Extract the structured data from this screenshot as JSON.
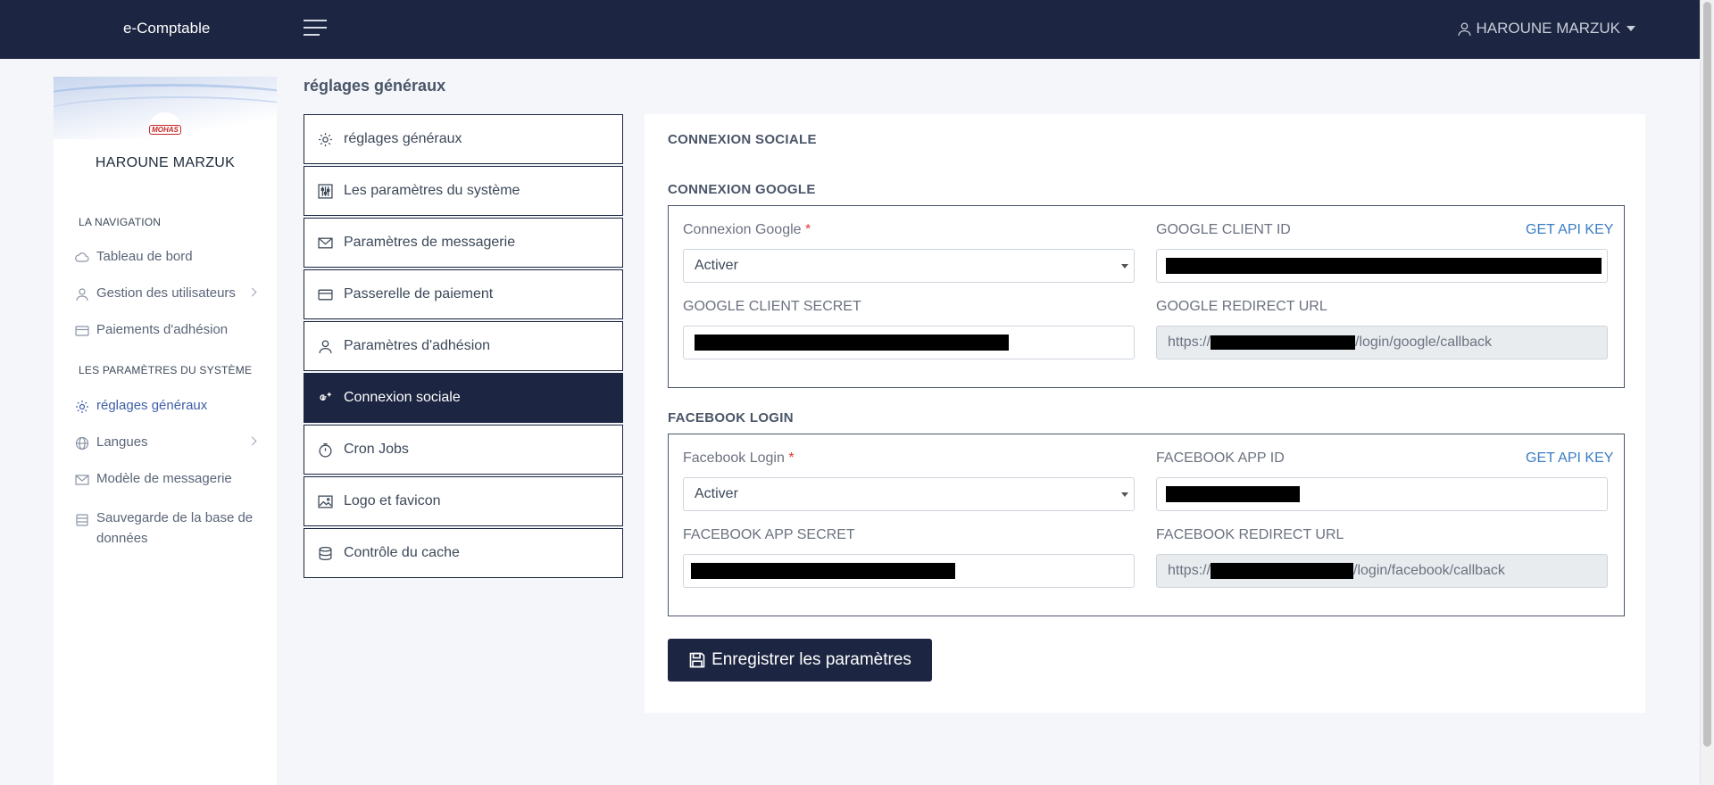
{
  "app": {
    "brand": "e-Comptable"
  },
  "topbar": {
    "user_name": "HAROUNE MARZUK"
  },
  "sidebar": {
    "logo_text": "MOHAS",
    "profile_name": "HAROUNE MARZUK",
    "sections": [
      {
        "title": "LA NAVIGATION"
      },
      {
        "title": "LES PARAMÈTRES DU SYSTÈME"
      }
    ],
    "items": [
      {
        "label": "Tableau de bord",
        "icon": "cloud-icon"
      },
      {
        "label": "Gestion des utilisateurs",
        "icon": "user-icon"
      },
      {
        "label": "Paiements d'adhésion",
        "icon": "card-icon"
      },
      {
        "label": "réglages généraux",
        "icon": "gear-icon"
      },
      {
        "label": "Langues",
        "icon": "globe-icon"
      },
      {
        "label": "Modèle de messagerie",
        "icon": "envelope-icon"
      },
      {
        "label": "Sauvegarde de la base de",
        "label2": "données",
        "icon": "database-icon"
      }
    ]
  },
  "page": {
    "title": "réglages généraux"
  },
  "settings_menu": {
    "items": [
      {
        "label": "réglages généraux",
        "icon": "gear-icon"
      },
      {
        "label": "Les paramètres du système",
        "icon": "sliders-icon"
      },
      {
        "label": "Paramètres de messagerie",
        "icon": "envelope-icon"
      },
      {
        "label": "Passerelle de paiement",
        "icon": "card-icon"
      },
      {
        "label": "Paramètres d'adhésion",
        "icon": "user-icon"
      },
      {
        "label": "Connexion sociale",
        "icon": "google-plus-icon",
        "active": true
      },
      {
        "label": "Cron Jobs",
        "icon": "stopwatch-icon"
      },
      {
        "label": "Logo et favicon",
        "icon": "image-icon"
      },
      {
        "label": "Contrôle du cache",
        "icon": "database-icon"
      }
    ]
  },
  "card": {
    "title": "CONNEXION SOCIALE",
    "google": {
      "title": "CONNEXION GOOGLE",
      "login_label": "Connexion Google",
      "required_mark": "*",
      "login_value": "Activer",
      "client_id_label": "GOOGLE CLIENT ID",
      "api_link": "GET API KEY",
      "client_secret_label": "GOOGLE CLIENT SECRET",
      "redirect_label": "GOOGLE REDIRECT URL",
      "redirect_prefix": "https://",
      "redirect_suffix": "/login/google/callback"
    },
    "facebook": {
      "title": "FACEBOOK LOGIN",
      "login_label": "Facebook Login",
      "required_mark": "*",
      "login_value": "Activer",
      "app_id_label": "FACEBOOK APP ID",
      "api_link": "GET API KEY",
      "app_secret_label": "FACEBOOK APP SECRET",
      "redirect_label": "FACEBOOK REDIRECT URL",
      "redirect_prefix": "https://",
      "redirect_suffix": "/login/facebook/callback"
    },
    "save_label": "Enregistrer les paramètres"
  },
  "colors": {
    "navy": "#1c2541",
    "link": "#3b7dc4",
    "required": "#e53935"
  }
}
